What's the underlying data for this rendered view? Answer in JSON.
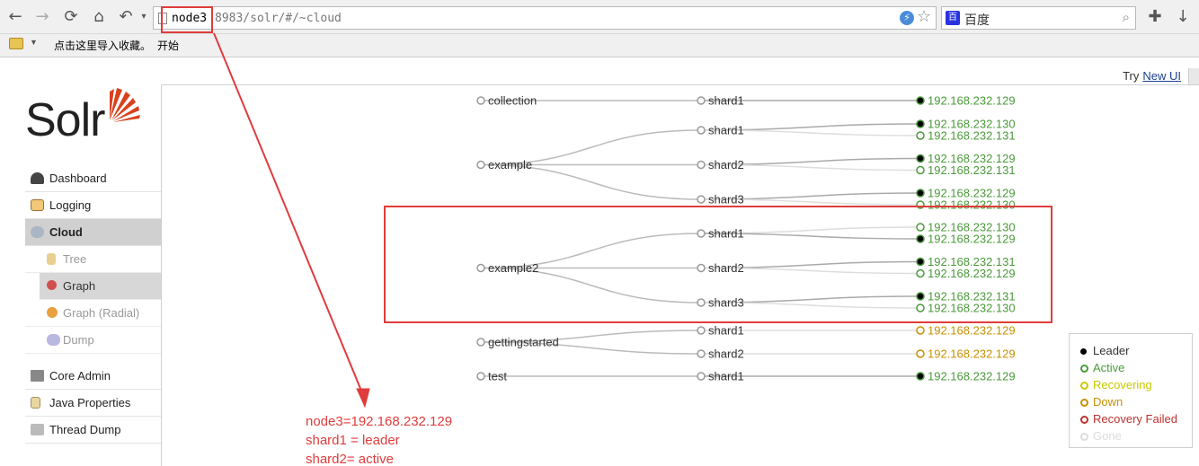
{
  "browser": {
    "url_host": "node3",
    "url_path": "8983/solr/#/~cloud",
    "search_placeholder": "百度",
    "search_logo_text": "百",
    "bookmarks": [
      "点击这里导入收藏。",
      "开始"
    ]
  },
  "try_new": {
    "prefix": "Try",
    "link": "New UI"
  },
  "logo": {
    "text": "Solr"
  },
  "menu": [
    {
      "label": "Dashboard",
      "icon": "dashboard-icon",
      "active": false
    },
    {
      "label": "Logging",
      "icon": "logging-icon",
      "active": false
    },
    {
      "label": "Cloud",
      "icon": "cloud-icon",
      "active": true
    },
    {
      "label": "Tree",
      "icon": "tree-icon",
      "sub": true
    },
    {
      "label": "Graph",
      "icon": "graph-icon",
      "sub": true,
      "active": true
    },
    {
      "label": "Graph (Radial)",
      "icon": "graph-radial-icon",
      "sub": true
    },
    {
      "label": "Dump",
      "icon": "dump-icon",
      "sub": true
    },
    {
      "label": "Core Admin",
      "icon": "core-admin-icon"
    },
    {
      "label": "Java Properties",
      "icon": "java-properties-icon"
    },
    {
      "label": "Thread Dump",
      "icon": "thread-dump-icon"
    }
  ],
  "graph": {
    "collections": [
      {
        "name": "collection",
        "shards": [
          {
            "name": "shard1",
            "replicas": [
              {
                "ip": "192.168.232.129",
                "state": "leader"
              }
            ]
          }
        ]
      },
      {
        "name": "example",
        "shards": [
          {
            "name": "shard1",
            "replicas": [
              {
                "ip": "192.168.232.130",
                "state": "leader"
              },
              {
                "ip": "192.168.232.131",
                "state": "active"
              }
            ]
          },
          {
            "name": "shard2",
            "replicas": [
              {
                "ip": "192.168.232.129",
                "state": "leader"
              },
              {
                "ip": "192.168.232.131",
                "state": "active"
              }
            ]
          },
          {
            "name": "shard3",
            "replicas": [
              {
                "ip": "192.168.232.129",
                "state": "leader"
              },
              {
                "ip": "192.168.232.130",
                "state": "active"
              }
            ]
          }
        ]
      },
      {
        "name": "example2",
        "shards": [
          {
            "name": "shard1",
            "replicas": [
              {
                "ip": "192.168.232.130",
                "state": "active"
              },
              {
                "ip": "192.168.232.129",
                "state": "leader"
              }
            ]
          },
          {
            "name": "shard2",
            "replicas": [
              {
                "ip": "192.168.232.131",
                "state": "leader"
              },
              {
                "ip": "192.168.232.129",
                "state": "active"
              }
            ]
          },
          {
            "name": "shard3",
            "replicas": [
              {
                "ip": "192.168.232.131",
                "state": "leader"
              },
              {
                "ip": "192.168.232.130",
                "state": "active"
              }
            ]
          }
        ]
      },
      {
        "name": "gettingstarted",
        "shards": [
          {
            "name": "shard1",
            "replicas": [
              {
                "ip": "192.168.232.129",
                "state": "down"
              }
            ]
          },
          {
            "name": "shard2",
            "replicas": [
              {
                "ip": "192.168.232.129",
                "state": "down"
              }
            ]
          }
        ]
      },
      {
        "name": "test",
        "shards": [
          {
            "name": "shard1",
            "replicas": [
              {
                "ip": "192.168.232.129",
                "state": "leader"
              }
            ]
          }
        ]
      }
    ]
  },
  "legend": [
    {
      "label": "Leader",
      "color": "#000000",
      "fill": true
    },
    {
      "label": "Active",
      "color": "#4a9a3a"
    },
    {
      "label": "Recovering",
      "color": "#c8c800"
    },
    {
      "label": "Down",
      "color": "#c89000"
    },
    {
      "label": "Recovery Failed",
      "color": "#c03030"
    },
    {
      "label": "Gone",
      "color": "#dddddd"
    }
  ],
  "annotation": {
    "lines": [
      "node3=192.168.232.129",
      "shard1 = leader",
      "shard2= active"
    ],
    "color": "#e03c3c"
  },
  "colors": {
    "ip_text": "#4a9a3a",
    "down": "#c89000",
    "edge": "#bbbbbb"
  }
}
